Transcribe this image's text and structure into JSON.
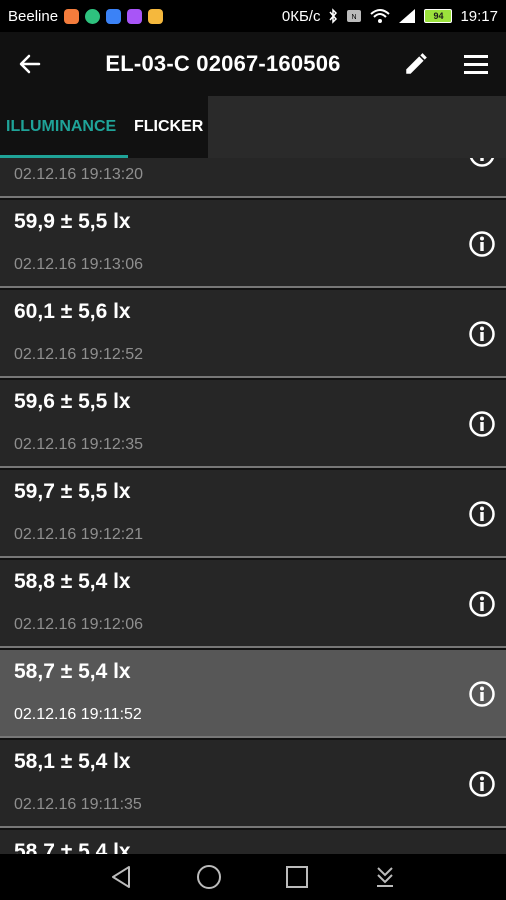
{
  "status_bar": {
    "carrier": "Beeline",
    "speed": "0КБ/с",
    "battery": "94",
    "time": "19:17",
    "notif_colors": [
      "#f47c3c",
      "#2ec27e",
      "#3b82f6",
      "#a855f7",
      "#f5b83d"
    ]
  },
  "app_bar": {
    "title": "EL-03-C 02067-160506"
  },
  "tabs": {
    "illuminance": "ILLUMINANCE",
    "flicker": "FLICKER"
  },
  "accent_color": "#1fa398",
  "measurements": [
    {
      "value": "",
      "time": "02.12.16 19:13:20",
      "partial": "top"
    },
    {
      "value": "59,9 ± 5,5 lx",
      "time": "02.12.16 19:13:06"
    },
    {
      "value": "60,1 ± 5,6 lx",
      "time": "02.12.16 19:12:52"
    },
    {
      "value": "59,6 ± 5,5 lx",
      "time": "02.12.16 19:12:35"
    },
    {
      "value": "59,7 ± 5,5 lx",
      "time": "02.12.16 19:12:21"
    },
    {
      "value": "58,8 ± 5,4 lx",
      "time": "02.12.16 19:12:06"
    },
    {
      "value": "58,7 ± 5,4 lx",
      "time": "02.12.16 19:11:52",
      "highlight": true
    },
    {
      "value": "58,1 ± 5,4 lx",
      "time": "02.12.16 19:11:35"
    },
    {
      "value": "58,7 ± 5,4 lx",
      "time": "",
      "partial": "bottom"
    }
  ]
}
